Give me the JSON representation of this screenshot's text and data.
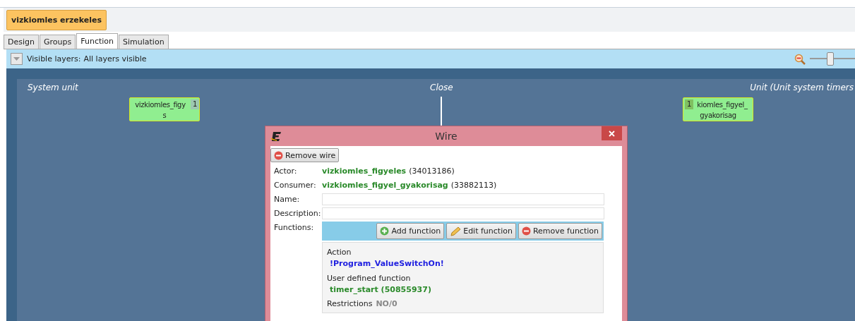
{
  "project_button": "vizkiomles erzekeles",
  "tabs": [
    {
      "label": "Design",
      "selected": false
    },
    {
      "label": "Groups",
      "selected": false
    },
    {
      "label": "Function",
      "selected": true
    },
    {
      "label": "Simulation",
      "selected": false
    }
  ],
  "toolbar": {
    "label": "Visible layers:",
    "value": "All layers visible",
    "zoom": {
      "level": 0.45
    }
  },
  "canvas": {
    "sections": [
      {
        "kind": "left",
        "label": "System unit"
      },
      {
        "kind": "center",
        "label": "Close"
      },
      {
        "kind": "right",
        "label": "Unit (Unit system timers"
      }
    ],
    "nodes": [
      {
        "kind": "left",
        "badge": "1",
        "lines": [
          "vizkiomles_figy",
          "s"
        ]
      },
      {
        "kind": "right",
        "badge": "1",
        "lines": [
          "kiomles_figyel_",
          "gyakorisag"
        ]
      }
    ]
  },
  "dialog": {
    "title": "Wire",
    "remove_button": "Remove wire",
    "fields": [
      {
        "label": "Actor:",
        "name": "vizkiomles_figyeles",
        "id": "(34013186)"
      },
      {
        "label": "Consumer:",
        "name": "vizkiomles_figyel_gyakorisag",
        "id": "(33882113)"
      }
    ],
    "inputs": [
      {
        "label": "Name:"
      },
      {
        "label": "Description:"
      }
    ],
    "functions_label": "Functions:",
    "function_buttons": [
      {
        "kind": "add",
        "label": "Add function"
      },
      {
        "kind": "edit",
        "label": "Edit function"
      },
      {
        "kind": "remove",
        "label": "Remove function"
      }
    ],
    "function": {
      "action_label": "Action",
      "action": "!Program_ValueSwitchOn!",
      "udf_label": "User defined function",
      "udf": "timer_start (50855937)",
      "restrictions_label": "Restrictions",
      "restrictions": "NO/0"
    }
  }
}
